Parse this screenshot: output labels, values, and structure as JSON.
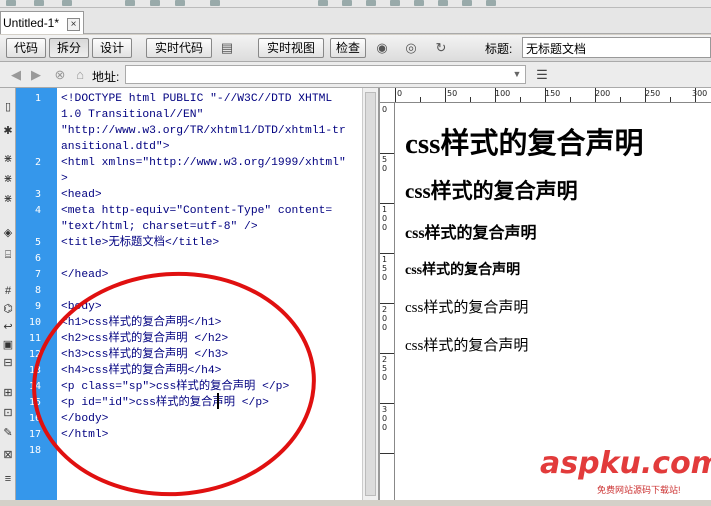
{
  "document_tab": {
    "name": "Untitled-1*",
    "close": "×"
  },
  "toolbar": {
    "code": "代码",
    "split": "拆分",
    "design": "设计",
    "live_code": "实时代码",
    "live_view": "实时视图",
    "inspect": "检查",
    "title_label": "标题:",
    "title_value": "无标题文档"
  },
  "address_bar": {
    "label": "地址:",
    "value": ""
  },
  "line_numbers": [
    "1",
    "2",
    "3",
    "4",
    "5",
    "6",
    "7",
    "8",
    "9",
    "10",
    "11",
    "12",
    "13",
    "14",
    "15",
    "16",
    "17",
    "18"
  ],
  "code_lines": [
    "<!DOCTYPE html PUBLIC \"-//W3C//DTD XHTML",
    "1.0 Transitional//EN\"",
    "\"http://www.w3.org/TR/xhtml1/DTD/xhtml1-tr",
    "ansitional.dtd\">",
    "<html xmlns=\"http://www.w3.org/1999/xhtml\"",
    ">",
    "<head>",
    "<meta http-equiv=\"Content-Type\" content=",
    "\"text/html; charset=utf-8\" />",
    "<title>无标题文档</title>",
    "",
    "</head>",
    "",
    "<body>",
    "<h1>css样式的复合声明</h1>",
    "<h2>css样式的复合声明 </h2>",
    "<h3>css样式的复合声明 </h3>",
    "<h4>css样式的复合声明</h4>",
    "<p class=\"sp\">css样式的复合声明 </p>",
    "<p id=\"id\">css样式的复合声明 </p>",
    "</body>",
    "</html>"
  ],
  "ruler": {
    "h_labels": [
      "0",
      "50",
      "100",
      "150",
      "200",
      "250",
      "300"
    ],
    "v_labels": [
      "0",
      "50",
      "100",
      "150",
      "200",
      "250",
      "300"
    ]
  },
  "design_view": {
    "h1": "css样式的复合声明",
    "h2": "css样式的复合声明",
    "h3": "css样式的复合声明",
    "h4": "css样式的复合声明",
    "p1": "css样式的复合声明",
    "p2": "css样式的复合声明"
  },
  "watermark": {
    "brand": "aspku.com",
    "tagline": "免费网站源码下载站!"
  },
  "colors": {
    "gutter": "#3597eb",
    "code_text": "#000080",
    "annotation": "#e01010"
  }
}
